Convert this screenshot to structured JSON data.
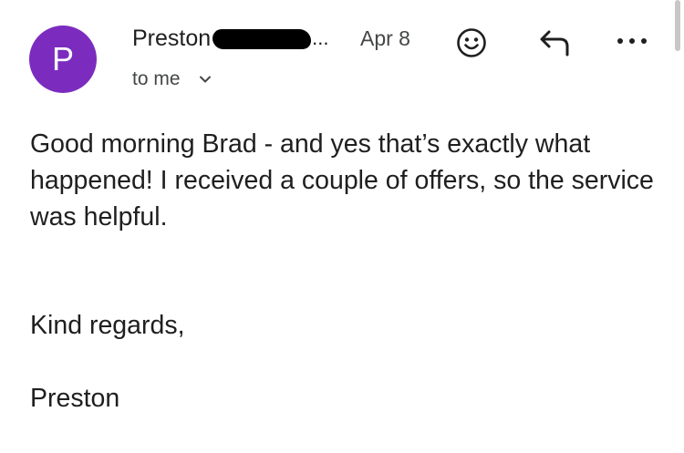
{
  "header": {
    "avatar_initial": "P",
    "avatar_color": "#7b2cbf",
    "sender_name": "Preston",
    "sender_truncation": "...",
    "date": "Apr 8",
    "recipient": "to me"
  },
  "actions": {
    "emoji_icon": "smiley-face-icon",
    "reply_icon": "reply-arrow-icon",
    "more_icon": "more-dots-icon",
    "recipient_chevron_icon": "chevron-down-icon"
  },
  "message": {
    "body": "Good morning Brad - and yes that’s exactly what happened! I received a couple of offers, so the service was helpful.",
    "closing": "Kind regards,",
    "signature": "Preston"
  },
  "colors": {
    "text": "#1f1f1f",
    "secondary_text": "#444746",
    "background": "#ffffff"
  }
}
